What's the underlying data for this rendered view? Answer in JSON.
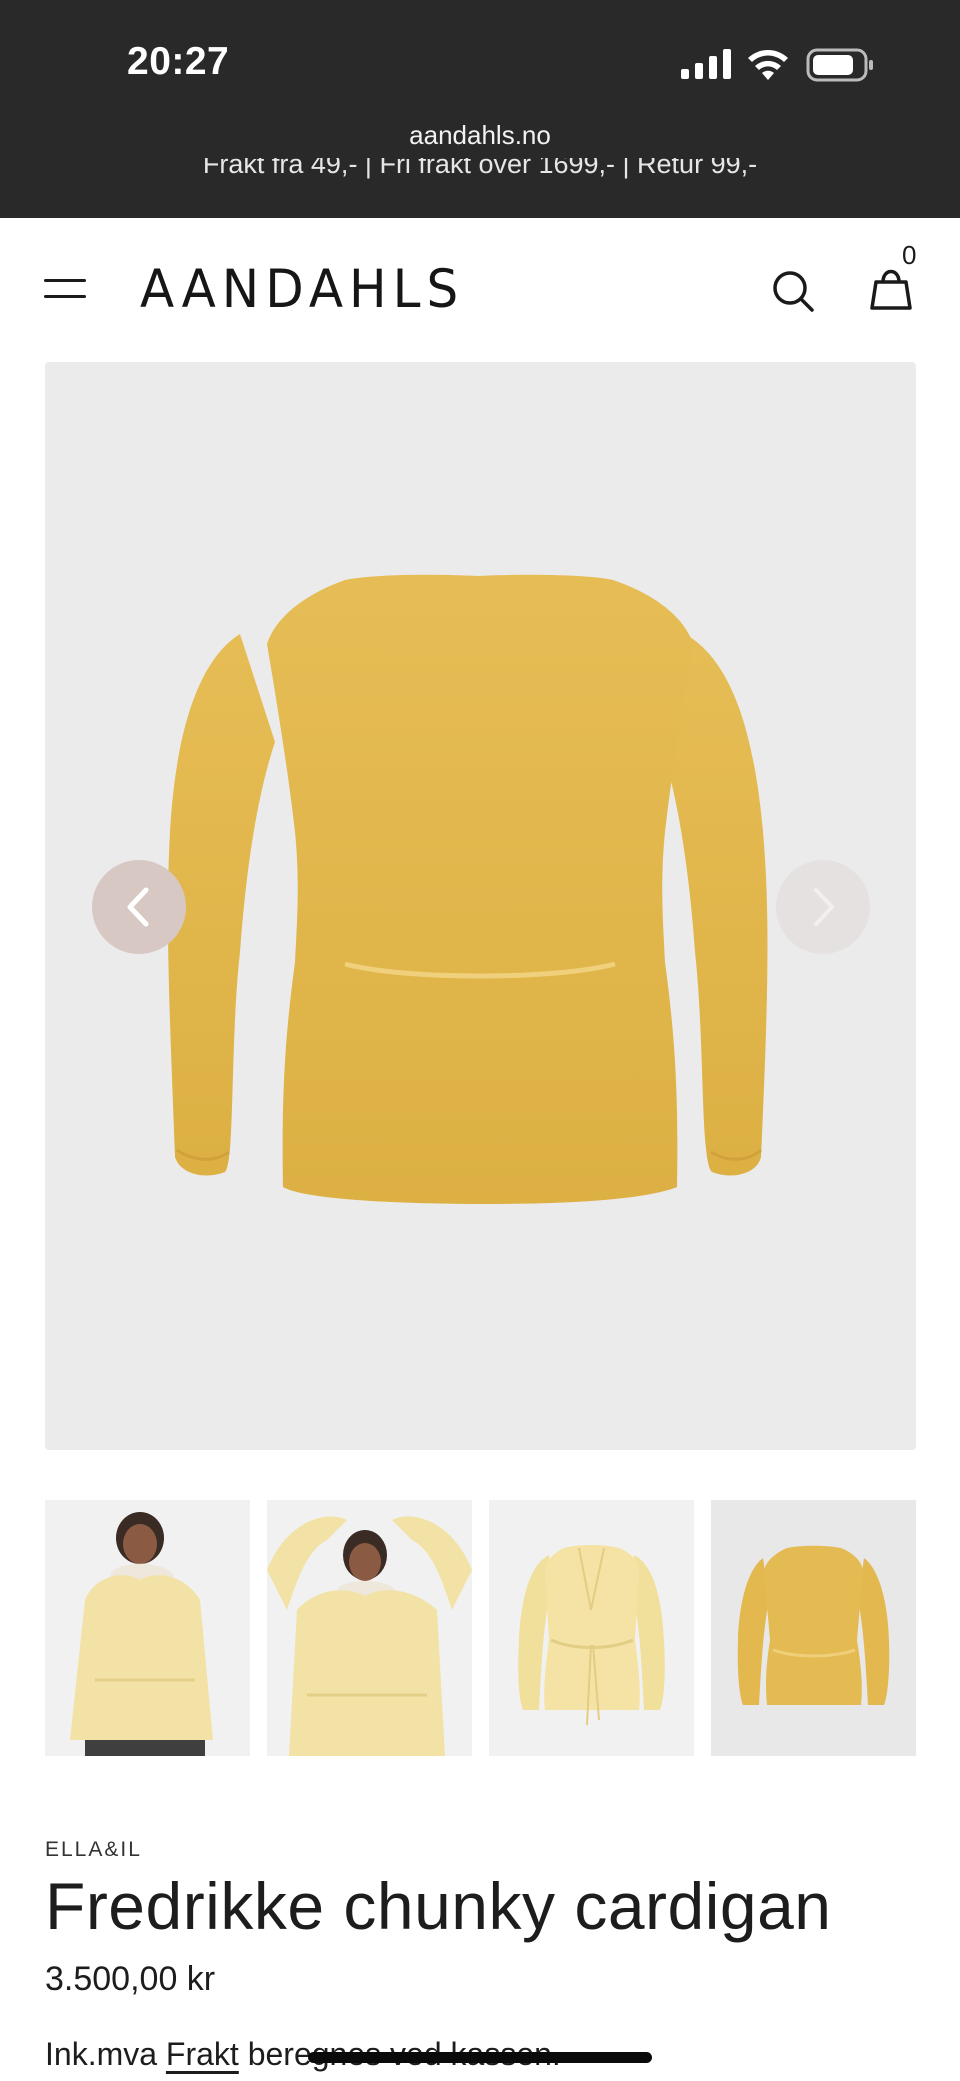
{
  "status_bar": {
    "time": "20:27",
    "signal_icon": "cellular-signal-icon",
    "wifi_icon": "wifi-icon",
    "battery_icon": "battery-icon"
  },
  "browser": {
    "url": "aandahls.no"
  },
  "promo_banner": {
    "text": "Frakt fra 49,- | Fri frakt over 1699,- | Retur 99,-"
  },
  "header": {
    "logo": "AANDAHLS",
    "cart_count": "0",
    "icons": [
      "menu-icon",
      "search-icon",
      "shopping-bag-icon"
    ]
  },
  "gallery": {
    "main_image": "yellow-cardigan-back-view",
    "thumbnails": [
      "model-front-view",
      "model-arms-raised",
      "cardigan-front-flat",
      "cardigan-back-flat"
    ],
    "prev_icon": "chevron-left-icon",
    "next_icon": "chevron-right-icon"
  },
  "product": {
    "brand": "ELLA&IL",
    "title": "Fredrikke chunky cardigan",
    "price": "3.500,00 kr",
    "tax_prefix": "Ink.mva",
    "shipping_link": "Frakt",
    "tax_suffix": "beregnes ved kassen."
  },
  "colors": {
    "topbar": "#292929",
    "cardigan_yellow": "#e3b94e",
    "image_bg": "#ecebec",
    "prev_button": "#d8c8c3"
  }
}
